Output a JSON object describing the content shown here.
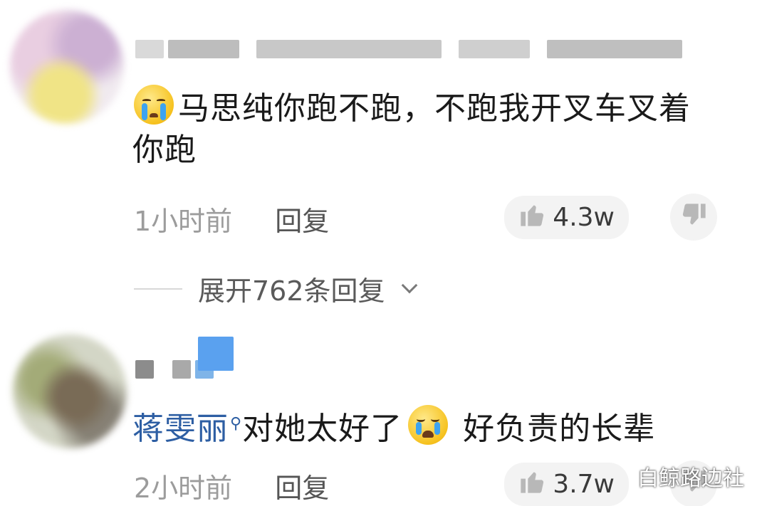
{
  "comments": [
    {
      "text_emoji": "crying-face-emoji",
      "text": "马思纯你跑不跑，不跑我开叉车叉着你跑",
      "time": "1小时前",
      "reply_label": "回复",
      "likes": "4.3w",
      "expand_label": "展开762条回复"
    },
    {
      "mention": "蒋雯丽",
      "text": "对她太好了",
      "text_emoji": "tearful-joy-emoji",
      "text_after": " 好负责的长辈",
      "time": "2小时前",
      "reply_label": "回复",
      "likes": "3.7w"
    }
  ],
  "watermark": "白鲸路边社",
  "colors": {
    "mention": "#2d5ea3",
    "meta": "#9c9c9c",
    "like_bg": "#f3f3f3"
  }
}
